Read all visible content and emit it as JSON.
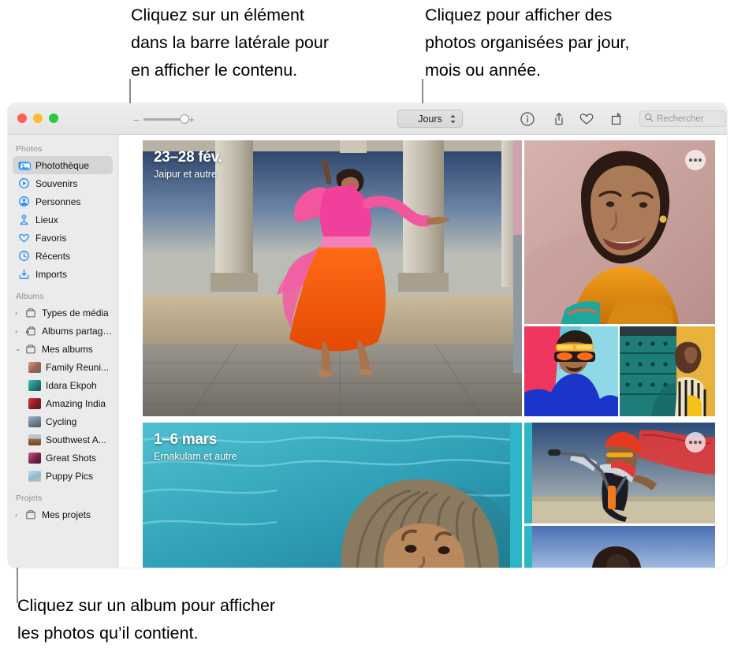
{
  "callouts": {
    "sidebar": "Cliquez sur un élément\ndans la barre latérale pour\nen afficher le contenu.",
    "mode": "Cliquez pour afficher des\nphotos organisées par jour,\nmois ou année.",
    "album": "Cliquez sur un album pour afficher\nles photos qu’il contient."
  },
  "window": {
    "traffic_lights": [
      "close",
      "minimize",
      "zoom"
    ],
    "toolbar": {
      "zoom_out_label": "–",
      "zoom_in_label": "+",
      "view_mode": "Jours",
      "icons": [
        "info-icon",
        "share-icon",
        "heart-icon",
        "rotate-icon"
      ],
      "search_placeholder": "Rechercher"
    }
  },
  "sidebar": {
    "sections": [
      {
        "header": "Photos",
        "items": [
          {
            "label": "Photothèque",
            "icon": "photo-library-icon",
            "selected": true
          },
          {
            "label": "Souvenirs",
            "icon": "memories-icon",
            "selected": false
          },
          {
            "label": "Personnes",
            "icon": "people-icon",
            "selected": false
          },
          {
            "label": "Lieux",
            "icon": "places-icon",
            "selected": false
          },
          {
            "label": "Favoris",
            "icon": "heart-icon",
            "selected": false
          },
          {
            "label": "Récents",
            "icon": "clock-icon",
            "selected": false
          },
          {
            "label": "Imports",
            "icon": "import-icon",
            "selected": false
          }
        ]
      },
      {
        "header": "Albums",
        "items": [
          {
            "label": "Types de média",
            "icon": "folder-icon",
            "twisty": "›",
            "type": "group"
          },
          {
            "label": "Albums partagés",
            "icon": "shared-folder-icon",
            "twisty": "›",
            "type": "group"
          },
          {
            "label": "Mes albums",
            "icon": "folder-icon",
            "twisty": "⌄",
            "type": "group"
          },
          {
            "label": "Family Reuni...",
            "thumb": "#c98b7e",
            "type": "album"
          },
          {
            "label": "Idara Ekpoh",
            "thumb": "#2e9f9a",
            "type": "album"
          },
          {
            "label": "Amazing India",
            "thumb": "#b2243a",
            "type": "album"
          },
          {
            "label": "Cycling",
            "thumb": "#7a8b9c",
            "type": "album"
          },
          {
            "label": "Southwest A...",
            "thumb": "#8a6a52",
            "type": "album"
          },
          {
            "label": "Great Shots",
            "thumb": "#8d2d56",
            "type": "album"
          },
          {
            "label": "Puppy Pics",
            "thumb": "#9ec6dd",
            "type": "album"
          }
        ]
      },
      {
        "header": "Projets",
        "items": [
          {
            "label": "Mes projets",
            "icon": "folder-icon",
            "twisty": "›",
            "type": "group"
          }
        ]
      }
    ]
  },
  "content": {
    "groups": [
      {
        "title": "23–28 fév.",
        "subtitle": "Jaipur et autre"
      },
      {
        "title": "1–6 mars",
        "subtitle": "Ernakulam et autre"
      }
    ]
  }
}
